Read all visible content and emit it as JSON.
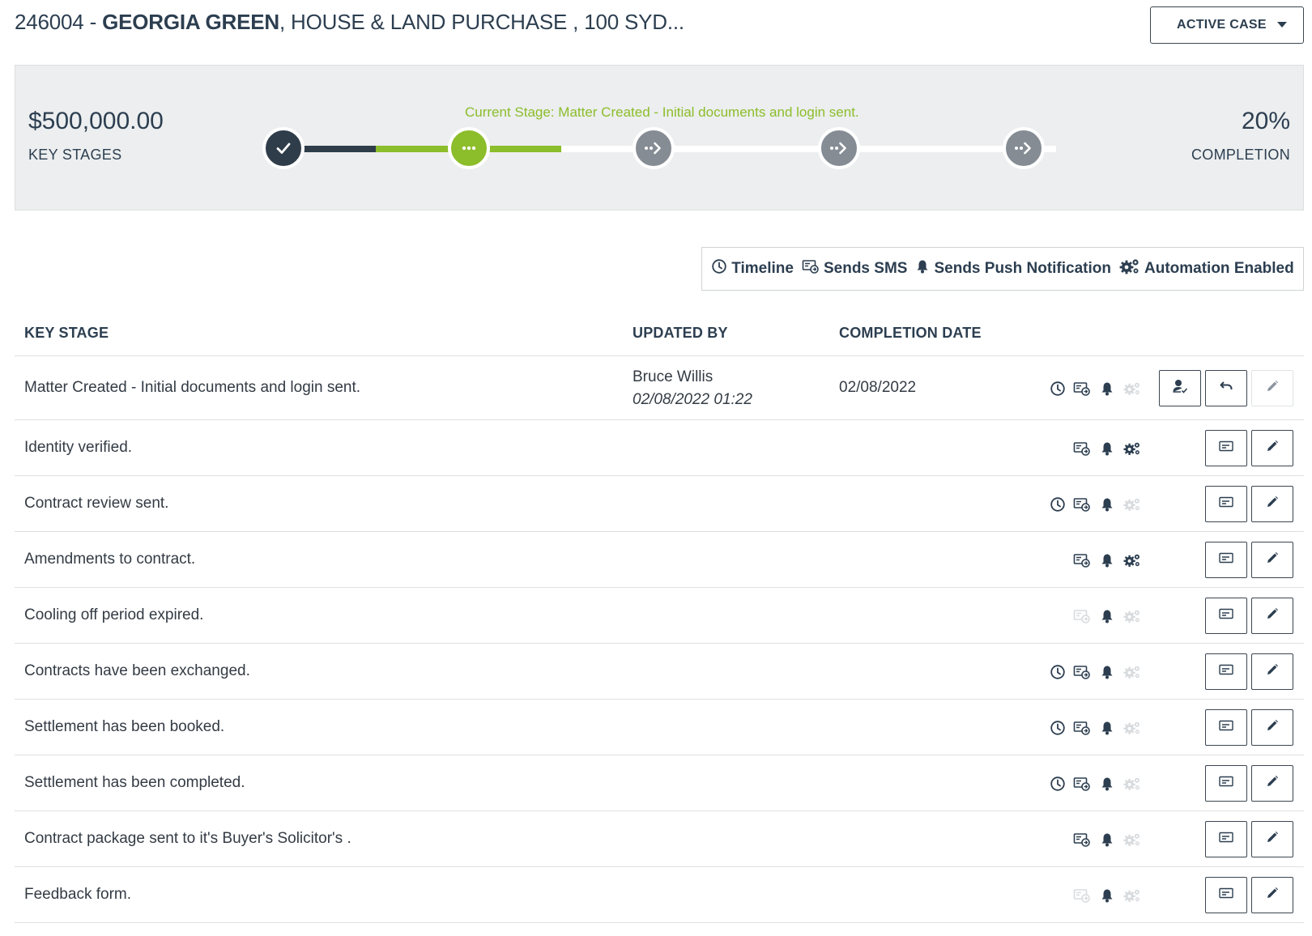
{
  "header": {
    "case_number": "246004 - ",
    "client_name": "GEORGIA GREEN",
    "matter_desc": ", HOUSE & LAND PURCHASE , 100 SYD...",
    "status_label": "ACTIVE CASE"
  },
  "progress": {
    "amount": "$500,000.00",
    "amount_label": "KEY STAGES",
    "current_stage_text": "Current Stage: Matter Created - Initial documents and login sent.",
    "percent_text": "20%",
    "percent_label": "COMPLETION",
    "completion_fraction": 0.2,
    "nodes": [
      "done",
      "current",
      "pending",
      "pending",
      "pending"
    ],
    "colors": {
      "done": "#2f3d4a",
      "current": "#8cbd2a",
      "pending": "#858c94"
    }
  },
  "legend": {
    "timeline": "Timeline",
    "sms": "Sends SMS",
    "push": "Sends Push Notification",
    "automation": "Automation Enabled"
  },
  "table": {
    "headers": {
      "stage": "KEY STAGE",
      "updated_by": "UPDATED BY",
      "completion_date": "COMPLETION DATE"
    },
    "rows": [
      {
        "stage": "Matter Created - Initial documents and login sent.",
        "updated_by": "Bruce Willis",
        "updated_at": "02/08/2022 01:22",
        "completion_date": "02/08/2022",
        "timeline": true,
        "sms": true,
        "push": true,
        "automation": false,
        "completed": true
      },
      {
        "stage": "Identity verified.",
        "updated_by": "",
        "updated_at": "",
        "completion_date": "",
        "timeline": false,
        "sms": true,
        "push": true,
        "automation": true,
        "completed": false
      },
      {
        "stage": "Contract review sent.",
        "updated_by": "",
        "updated_at": "",
        "completion_date": "",
        "timeline": true,
        "sms": true,
        "push": true,
        "automation": false,
        "completed": false
      },
      {
        "stage": "Amendments to contract.",
        "updated_by": "",
        "updated_at": "",
        "completion_date": "",
        "timeline": false,
        "sms": true,
        "push": true,
        "automation": true,
        "completed": false
      },
      {
        "stage": "Cooling off period expired.",
        "updated_by": "",
        "updated_at": "",
        "completion_date": "",
        "timeline": false,
        "sms": false,
        "push": true,
        "automation": false,
        "completed": false
      },
      {
        "stage": "Contracts have been exchanged.",
        "updated_by": "",
        "updated_at": "",
        "completion_date": "",
        "timeline": true,
        "sms": true,
        "push": true,
        "automation": false,
        "completed": false
      },
      {
        "stage": "Settlement has been booked.",
        "updated_by": "",
        "updated_at": "",
        "completion_date": "",
        "timeline": true,
        "sms": true,
        "push": true,
        "automation": false,
        "completed": false
      },
      {
        "stage": "Settlement has been completed.",
        "updated_by": "",
        "updated_at": "",
        "completion_date": "",
        "timeline": true,
        "sms": true,
        "push": true,
        "automation": false,
        "completed": false
      },
      {
        "stage": "Contract package sent to it's Buyer's Solicitor's .",
        "updated_by": "",
        "updated_at": "",
        "completion_date": "",
        "timeline": false,
        "sms": true,
        "push": true,
        "automation": false,
        "completed": false
      },
      {
        "stage": "Feedback form.",
        "updated_by": "",
        "updated_at": "",
        "completion_date": "",
        "timeline": false,
        "sms": false,
        "push": true,
        "automation": false,
        "completed": false
      }
    ]
  }
}
